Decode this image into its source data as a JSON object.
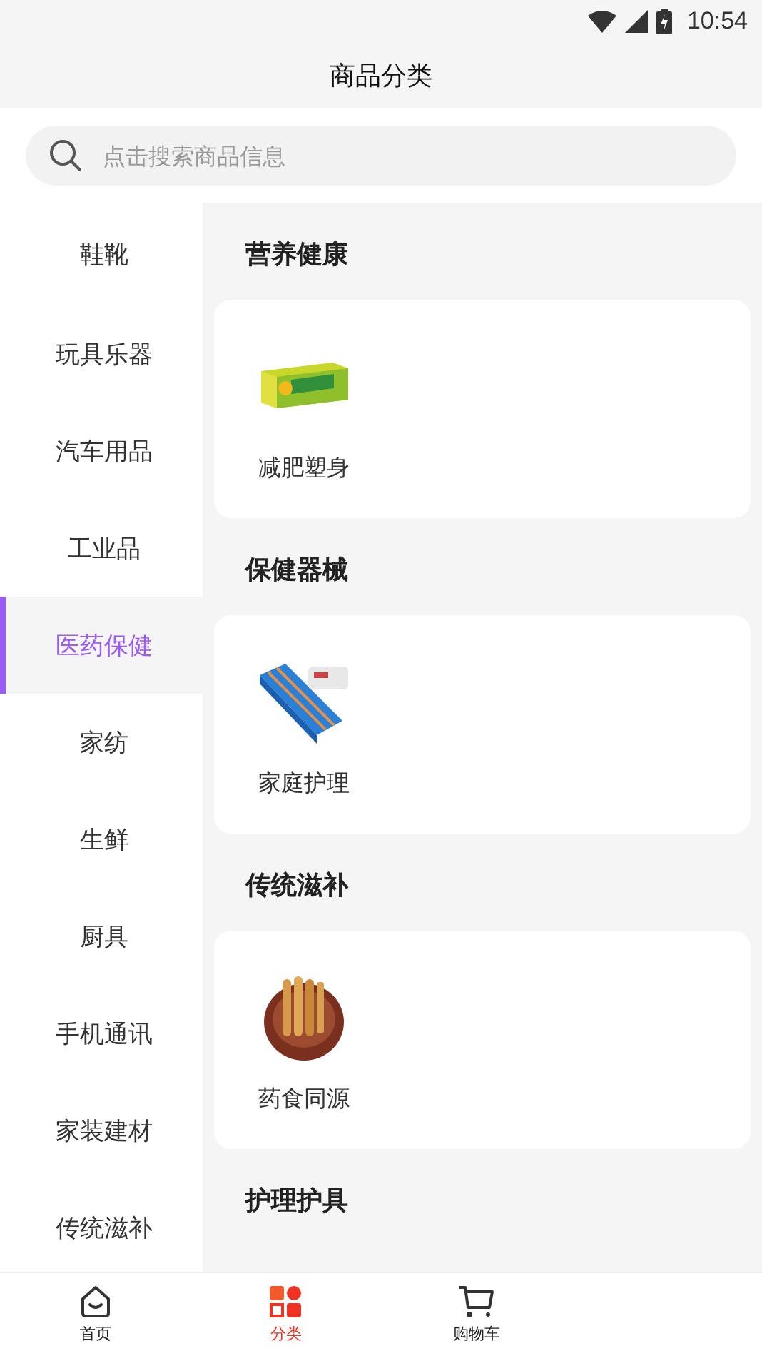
{
  "status_bar": {
    "time": "10:54"
  },
  "header": {
    "title": "商品分类"
  },
  "search": {
    "placeholder": "点击搜索商品信息"
  },
  "sidebar": {
    "items": [
      {
        "label": "鞋靴",
        "selected": false
      },
      {
        "label": "玩具乐器",
        "selected": false
      },
      {
        "label": "汽车用品",
        "selected": false
      },
      {
        "label": "工业品",
        "selected": false
      },
      {
        "label": "医药保健",
        "selected": true
      },
      {
        "label": "家纺",
        "selected": false
      },
      {
        "label": "生鲜",
        "selected": false
      },
      {
        "label": "厨具",
        "selected": false
      },
      {
        "label": "手机通讯",
        "selected": false
      },
      {
        "label": "家装建材",
        "selected": false
      },
      {
        "label": "传统滋补",
        "selected": false
      }
    ]
  },
  "sections": [
    {
      "title": "营养健康",
      "items": [
        {
          "label": "减肥塑身"
        }
      ]
    },
    {
      "title": "保健器械",
      "items": [
        {
          "label": "家庭护理"
        }
      ]
    },
    {
      "title": "传统滋补",
      "items": [
        {
          "label": "药食同源"
        }
      ]
    },
    {
      "title": "护理护具"
    }
  ],
  "tab_bar": {
    "items": [
      {
        "label": "首页",
        "selected": false
      },
      {
        "label": "分类",
        "selected": true
      },
      {
        "label": "购物车",
        "selected": false
      }
    ]
  }
}
